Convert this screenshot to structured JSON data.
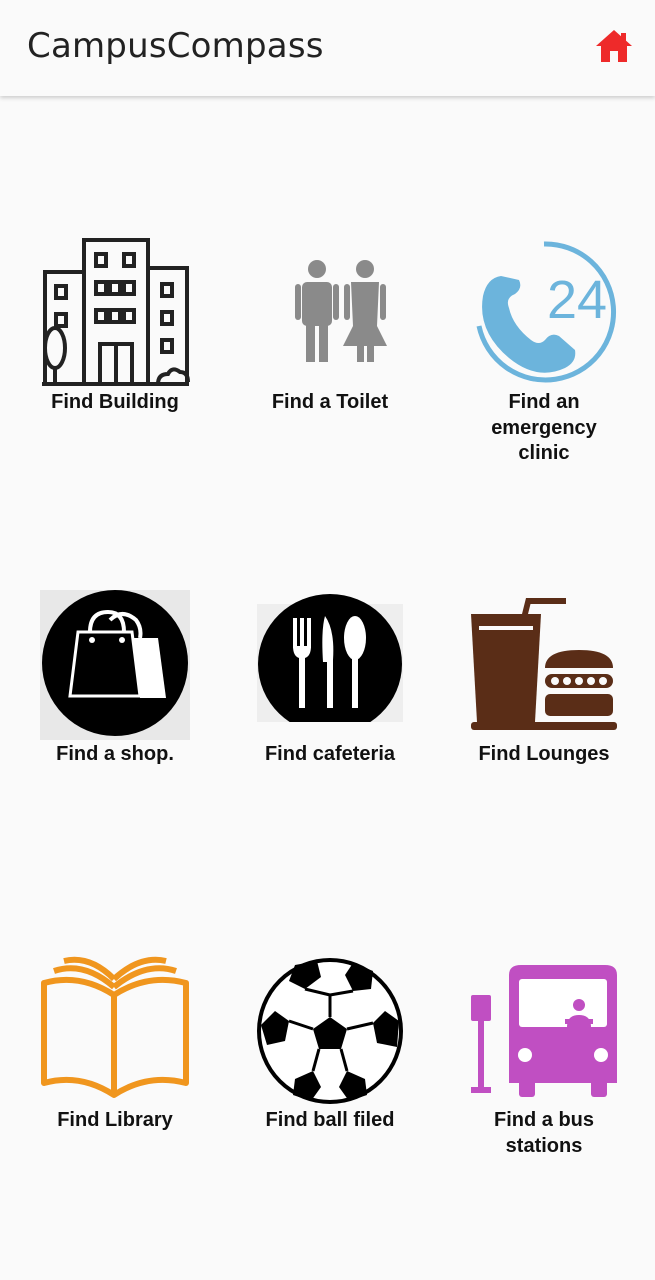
{
  "appbar": {
    "title": "CampusCompass",
    "home_icon": "home-icon",
    "home_color": "#ee2a2a"
  },
  "tiles": [
    {
      "label": "Find Building",
      "icon": "building-icon"
    },
    {
      "label": "Find a Toilet",
      "icon": "toilet-icon"
    },
    {
      "label": "Find an emergency clinic",
      "icon": "emergency-phone-24-icon"
    },
    {
      "label": "Find a shop.",
      "icon": "shopping-bag-icon"
    },
    {
      "label": "Find cafeteria",
      "icon": "cutlery-icon"
    },
    {
      "label": "Find Lounges",
      "icon": "drink-burger-icon"
    },
    {
      "label": "Find Library",
      "icon": "open-book-icon"
    },
    {
      "label": "Find ball filed",
      "icon": "soccer-ball-icon"
    },
    {
      "label": "Find a bus stations",
      "icon": "bus-station-icon"
    }
  ],
  "colors": {
    "phone_blue": "#6cb4dc",
    "book_orange": "#f0961e",
    "bus_purple": "#c04fc2",
    "lounge_brown": "#5a2d17",
    "toilet_gray": "#8a8a8a"
  }
}
